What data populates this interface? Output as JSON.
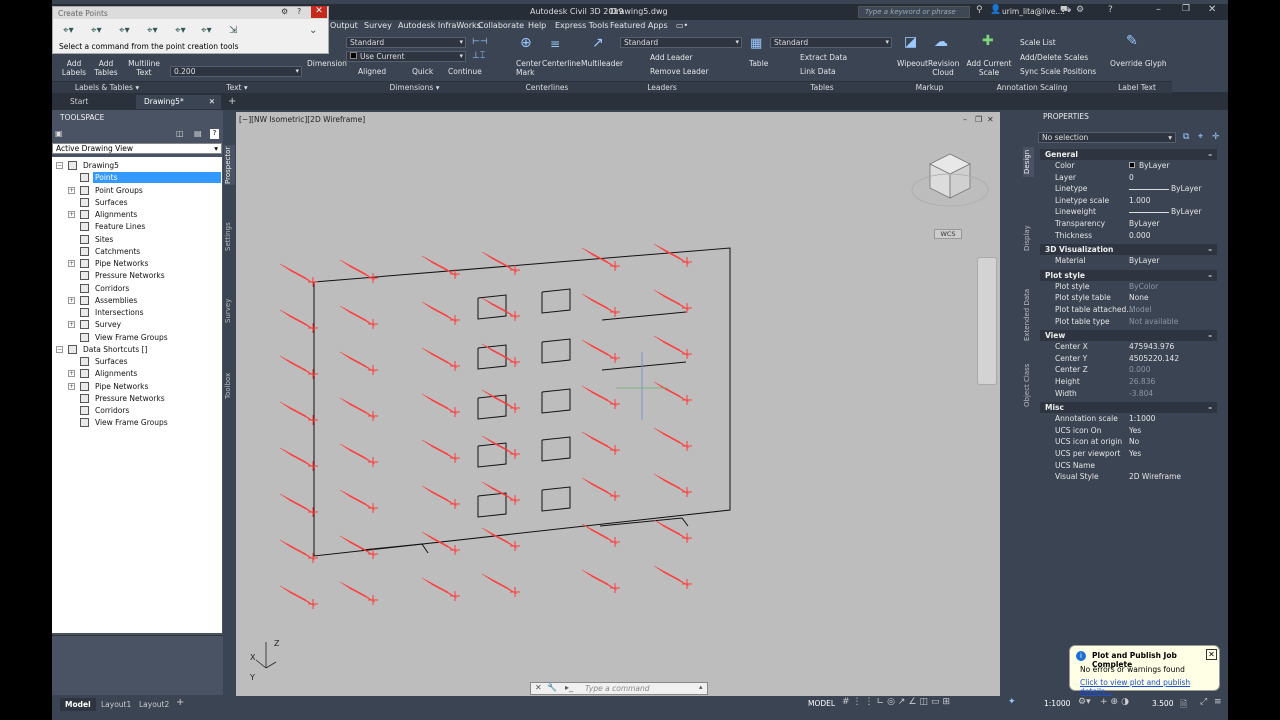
{
  "app": {
    "title": "Autodesk Civil 3D 2019",
    "file": "Drawing5.dwg",
    "search_placeholder": "Type a keyword or phrase",
    "user": "urim_lita@live...."
  },
  "create_points": {
    "title": "Create Points",
    "status": "Select a command from the point creation tools"
  },
  "menu": [
    "Output",
    "Survey",
    "Autodesk InfraWorks",
    "Collaborate",
    "Help",
    "Express Tools",
    "Featured Apps"
  ],
  "ribbon": {
    "labels_tables": {
      "add_labels": "Add Labels",
      "add_tables": "Add Tables",
      "multiline_text": "Multiline Text",
      "text_value": "0.200",
      "panel_a": "Labels & Tables",
      "panel_b": "Text"
    },
    "dimensions": {
      "dimension": "Dimension",
      "style": "Standard",
      "use_current": "Use Current",
      "aligned": "Aligned",
      "quick": "Quick",
      "continue": "Continue",
      "panel": "Dimensions"
    },
    "centerlines": {
      "center_mark": "Center Mark",
      "centerline": "Centerline",
      "panel": "Centerlines"
    },
    "leaders": {
      "multileader": "Multileader",
      "style": "Standard",
      "add_leader": "Add Leader",
      "remove_leader": "Remove Leader",
      "panel": "Leaders"
    },
    "tables": {
      "table": "Table",
      "style": "Standard",
      "extract_data": "Extract Data",
      "link_data": "Link Data",
      "panel": "Tables"
    },
    "markup": {
      "wipeout": "Wipeout",
      "revision_cloud": "Revision Cloud",
      "panel": "Markup"
    },
    "annotation_scaling": {
      "add_current_scale": "Add Current Scale",
      "scale_list": "Scale List",
      "add_delete_scales": "Add/Delete Scales",
      "sync_scale_positions": "Sync Scale Positions",
      "panel": "Annotation Scaling"
    },
    "label_text": {
      "override_glyph": "Override Glyph",
      "panel": "Label Text"
    }
  },
  "doc_tabs": [
    "Start",
    "Drawing5*"
  ],
  "toolspace": {
    "title": "TOOLSPACE",
    "view": "Active Drawing View",
    "tree": [
      {
        "label": "Drawing5",
        "level": 0,
        "selected": false
      },
      {
        "label": "Points",
        "level": 1,
        "selected": true
      },
      {
        "label": "Point Groups",
        "level": 1,
        "selected": false
      },
      {
        "label": "Surfaces",
        "level": 1,
        "selected": false
      },
      {
        "label": "Alignments",
        "level": 1,
        "selected": false
      },
      {
        "label": "Feature Lines",
        "level": 1,
        "selected": false
      },
      {
        "label": "Sites",
        "level": 1,
        "selected": false
      },
      {
        "label": "Catchments",
        "level": 1,
        "selected": false
      },
      {
        "label": "Pipe Networks",
        "level": 1,
        "selected": false
      },
      {
        "label": "Pressure Networks",
        "level": 1,
        "selected": false
      },
      {
        "label": "Corridors",
        "level": 1,
        "selected": false
      },
      {
        "label": "Assemblies",
        "level": 1,
        "selected": false
      },
      {
        "label": "Intersections",
        "level": 1,
        "selected": false
      },
      {
        "label": "Survey",
        "level": 1,
        "selected": false
      },
      {
        "label": "View Frame Groups",
        "level": 1,
        "selected": false
      },
      {
        "label": "Data Shortcuts []",
        "level": 0,
        "selected": false
      },
      {
        "label": "Surfaces",
        "level": 1,
        "selected": false
      },
      {
        "label": "Alignments",
        "level": 1,
        "selected": false
      },
      {
        "label": "Pipe Networks",
        "level": 1,
        "selected": false
      },
      {
        "label": "Pressure Networks",
        "level": 1,
        "selected": false
      },
      {
        "label": "Corridors",
        "level": 1,
        "selected": false
      },
      {
        "label": "View Frame Groups",
        "level": 1,
        "selected": false
      }
    ],
    "side_tabs": [
      "Prospector",
      "Settings",
      "Survey",
      "Toolbox"
    ]
  },
  "viewport": {
    "label": "[−][NW Isometric][2D Wireframe]",
    "wcs": "WCS"
  },
  "properties": {
    "title": "PROPERTIES",
    "selection": "No selection",
    "side_tabs": [
      "Design",
      "Display",
      "Extended Data",
      "Object Class"
    ],
    "sections": [
      {
        "name": "General",
        "rows": [
          [
            "Color",
            "ByLayer"
          ],
          [
            "Layer",
            "0"
          ],
          [
            "Linetype",
            "ByLayer"
          ],
          [
            "Linetype scale",
            "1.000"
          ],
          [
            "Lineweight",
            "ByLayer"
          ],
          [
            "Transparency",
            "ByLayer"
          ],
          [
            "Thickness",
            "0.000"
          ]
        ]
      },
      {
        "name": "3D Visualization",
        "rows": [
          [
            "Material",
            "ByLayer"
          ]
        ]
      },
      {
        "name": "Plot style",
        "rows": [
          [
            "Plot style",
            "ByColor"
          ],
          [
            "Plot style table",
            "None"
          ],
          [
            "Plot table attached...",
            "Model"
          ],
          [
            "Plot table type",
            "Not available"
          ]
        ]
      },
      {
        "name": "View",
        "rows": [
          [
            "Center X",
            "475943.976"
          ],
          [
            "Center Y",
            "4505220.142"
          ],
          [
            "Center Z",
            "0.000"
          ],
          [
            "Height",
            "26.836"
          ],
          [
            "Width",
            "-3.804"
          ]
        ]
      },
      {
        "name": "Misc",
        "rows": [
          [
            "Annotation scale",
            "1:1000"
          ],
          [
            "UCS icon On",
            "Yes"
          ],
          [
            "UCS icon at origin",
            "No"
          ],
          [
            "UCS per viewport",
            "Yes"
          ],
          [
            "UCS Name",
            ""
          ],
          [
            "Visual Style",
            "2D Wireframe"
          ]
        ]
      }
    ]
  },
  "layout_tabs": [
    "Model",
    "Layout1",
    "Layout2"
  ],
  "command_placeholder": "Type a command",
  "status": {
    "model": "MODEL",
    "scale": "1:1000",
    "value": "3.500"
  },
  "notification": {
    "title": "Plot and Publish Job Complete",
    "message": "No errors or warnings found",
    "link": "Click to view plot and publish details..."
  },
  "colors": {
    "point_red": "#ff3a3a",
    "viewport_bg": "#bdbdbd",
    "panel_bg": "#3b4453",
    "selection_blue": "#3399ff"
  }
}
